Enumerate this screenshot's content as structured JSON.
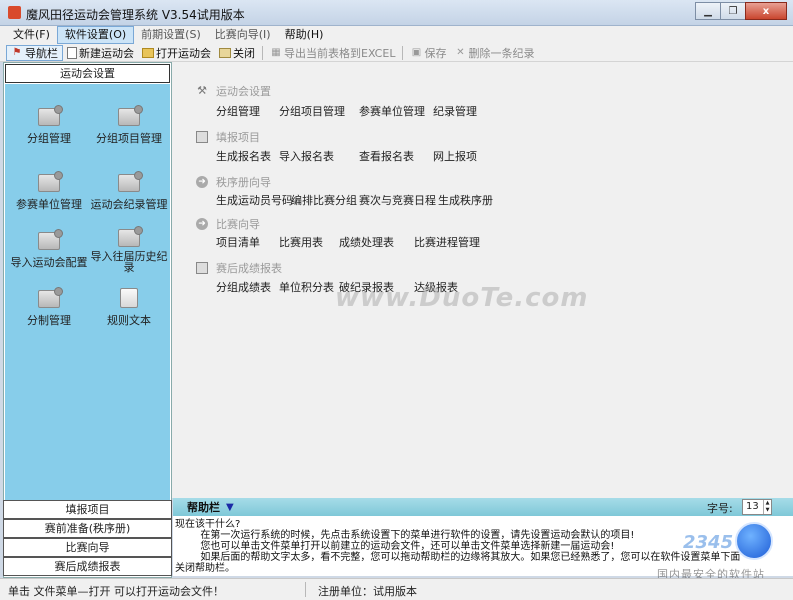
{
  "window": {
    "title": "魔风田径运动会管理系统 V3.54试用版本",
    "minimize_icon": "minimize-icon",
    "restore_icon": "restore-icon",
    "close_glyph": "x"
  },
  "menu": [
    "文件(F)",
    "软件设置(O)",
    "前期设置(S)",
    "比赛向导(I)",
    "帮助(H)"
  ],
  "toolbar": {
    "nav": "导航栏",
    "new_meet": "新建运动会",
    "open_meet": "打开运动会",
    "close": "关闭",
    "export": "导出当前表格到EXCEL",
    "save": "保存",
    "delete": "删除一条纪录"
  },
  "left_panel": {
    "header": "运动会设置",
    "items": [
      "分组管理",
      "分组项目管理",
      "参赛单位管理",
      "运动会纪录管理",
      "导入运动会配置",
      "导入往届历史纪录",
      "分制管理",
      "规则文本"
    ],
    "tabs": [
      "填报项目",
      "赛前准备(秩序册)",
      "比赛向导",
      "赛后成绩报表"
    ]
  },
  "main": {
    "sections": [
      {
        "title": "运动会设置",
        "links": [
          "分组管理",
          "分组项目管理",
          "参赛单位管理",
          "纪录管理"
        ]
      },
      {
        "title": "填报项目",
        "links": [
          "生成报名表",
          "导入报名表",
          "查看报名表",
          "网上报项"
        ]
      },
      {
        "title": "秩序册向导",
        "links": [
          "生成运动员号码",
          "编排比赛分组",
          "赛次与竞赛日程",
          "生成秩序册"
        ]
      },
      {
        "title": "比赛向导",
        "links": [
          "项目清单",
          "比赛用表",
          "成绩处理表",
          "比赛进程管理"
        ]
      },
      {
        "title": "赛后成绩报表",
        "links": [
          "分组成绩表",
          "单位积分表",
          "破纪录报表",
          "达级报表"
        ]
      }
    ],
    "watermark": "www.DuoTe.com"
  },
  "help": {
    "title": "帮助栏",
    "font_size_label": "字号:",
    "font_size_value": "13",
    "lines": [
      "现在该干什么?",
      "        在第一次运行系统的时候，先点击系统设置下的菜单进行软件的设置，请先设置运动会默认的项目!",
      "        您也可以单击文件菜单打开以前建立的运动会文件，还可以单击文件菜单选择新建一届运动会!",
      "        如果后面的帮助文字太多，看不完整，您可以拖动帮助栏的边缘将其放大。如果您已经熟悉了，您可以在软件设置菜单下面",
      "关闭帮助栏。"
    ]
  },
  "brand": {
    "number": "2345",
    "tagline": "国内最安全的软件站"
  },
  "status": {
    "left": "单击 文件菜单—打开 可以打开运动会文件！",
    "mid": "注册单位：试用版本"
  }
}
